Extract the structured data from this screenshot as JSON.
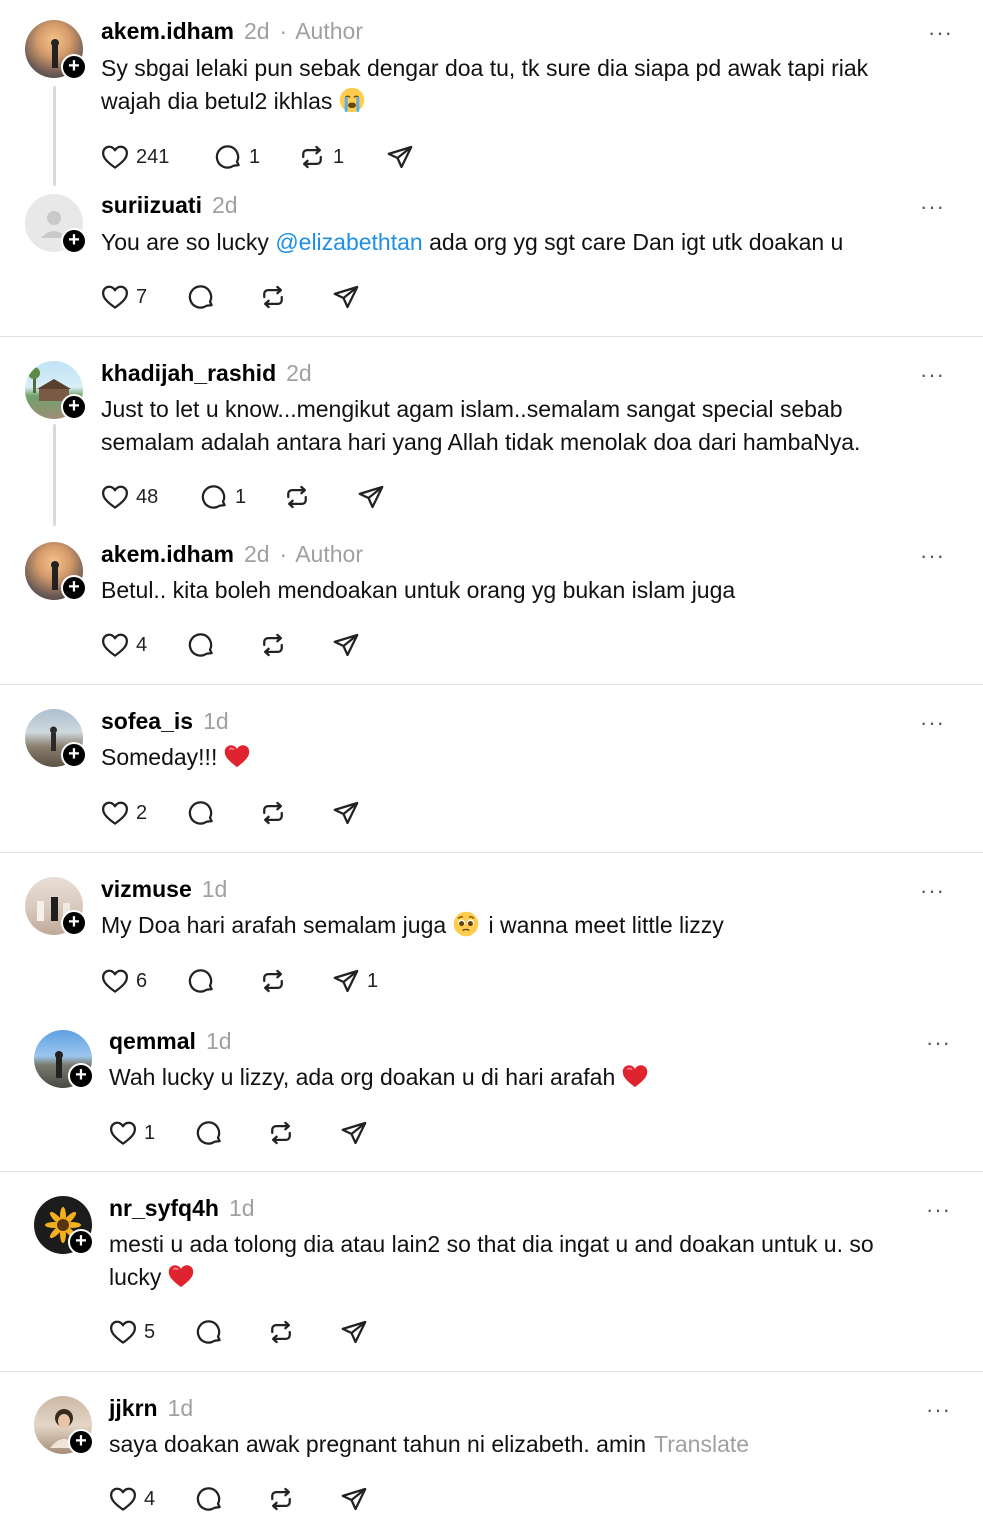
{
  "icons": {
    "like": "heart-icon",
    "reply": "comment-icon",
    "repost": "repost-icon",
    "share": "send-icon",
    "more": "more-icon",
    "follow": "plus-icon"
  },
  "colors": {
    "mention": "#1d8fe8",
    "muted": "#a0a0a0"
  },
  "posts": [
    {
      "username": "akem.idham",
      "time": "2d",
      "dot": "·",
      "author": "Author",
      "text": "Sy sbgai lelaki pun sebak dengar doa tu, tk sure dia siapa pd awak tapi riak wajah dia betul2 ikhlas",
      "emoji": "crying-face",
      "likes": "241",
      "replies": "1",
      "reposts": "1",
      "more": "···"
    },
    {
      "username": "suriizuati",
      "time": "2d",
      "text_pre": "You are so lucky ",
      "mention": "@elizabethtan",
      "text_post": " ada org yg sgt care Dan igt utk doakan u",
      "likes": "7",
      "more": "···"
    },
    {
      "username": "khadijah_rashid",
      "time": "2d",
      "text": "Just to let u know...mengikut agam islam..semalam sangat special sebab semalam adalah antara hari yang Allah tidak menolak doa dari hambaNya.",
      "likes": "48",
      "replies": "1",
      "more": "···"
    },
    {
      "username": "akem.idham",
      "time": "2d",
      "dot": "·",
      "author": "Author",
      "text": "Betul.. kita boleh mendoakan untuk orang yg bukan islam juga",
      "likes": "4",
      "more": "···"
    },
    {
      "username": "sofea_is",
      "time": "1d",
      "text": "Someday!!!",
      "emoji": "red-heart",
      "likes": "2",
      "more": "···"
    },
    {
      "username": "vizmuse",
      "time": "1d",
      "text_pre": "My Doa hari arafah semalam juga",
      "emoji": "pleading-face",
      "text_post": " i wanna meet little lizzy",
      "likes": "6",
      "shares": "1",
      "more": "···"
    },
    {
      "username": "qemmal",
      "time": "1d",
      "text": "Wah lucky u lizzy, ada org doakan u di hari arafah",
      "emoji": "red-heart",
      "likes": "1",
      "more": "···"
    },
    {
      "username": "nr_syfq4h",
      "time": "1d",
      "text": "mesti u ada tolong dia atau lain2 so that dia ingat u and doakan untuk u. so lucky",
      "emoji": "red-heart",
      "likes": "5",
      "more": "···"
    },
    {
      "username": "jjkrn",
      "time": "1d",
      "text": "saya doakan awak pregnant tahun ni elizabeth. amin",
      "translate": "Translate",
      "likes": "4",
      "more": "···"
    }
  ]
}
